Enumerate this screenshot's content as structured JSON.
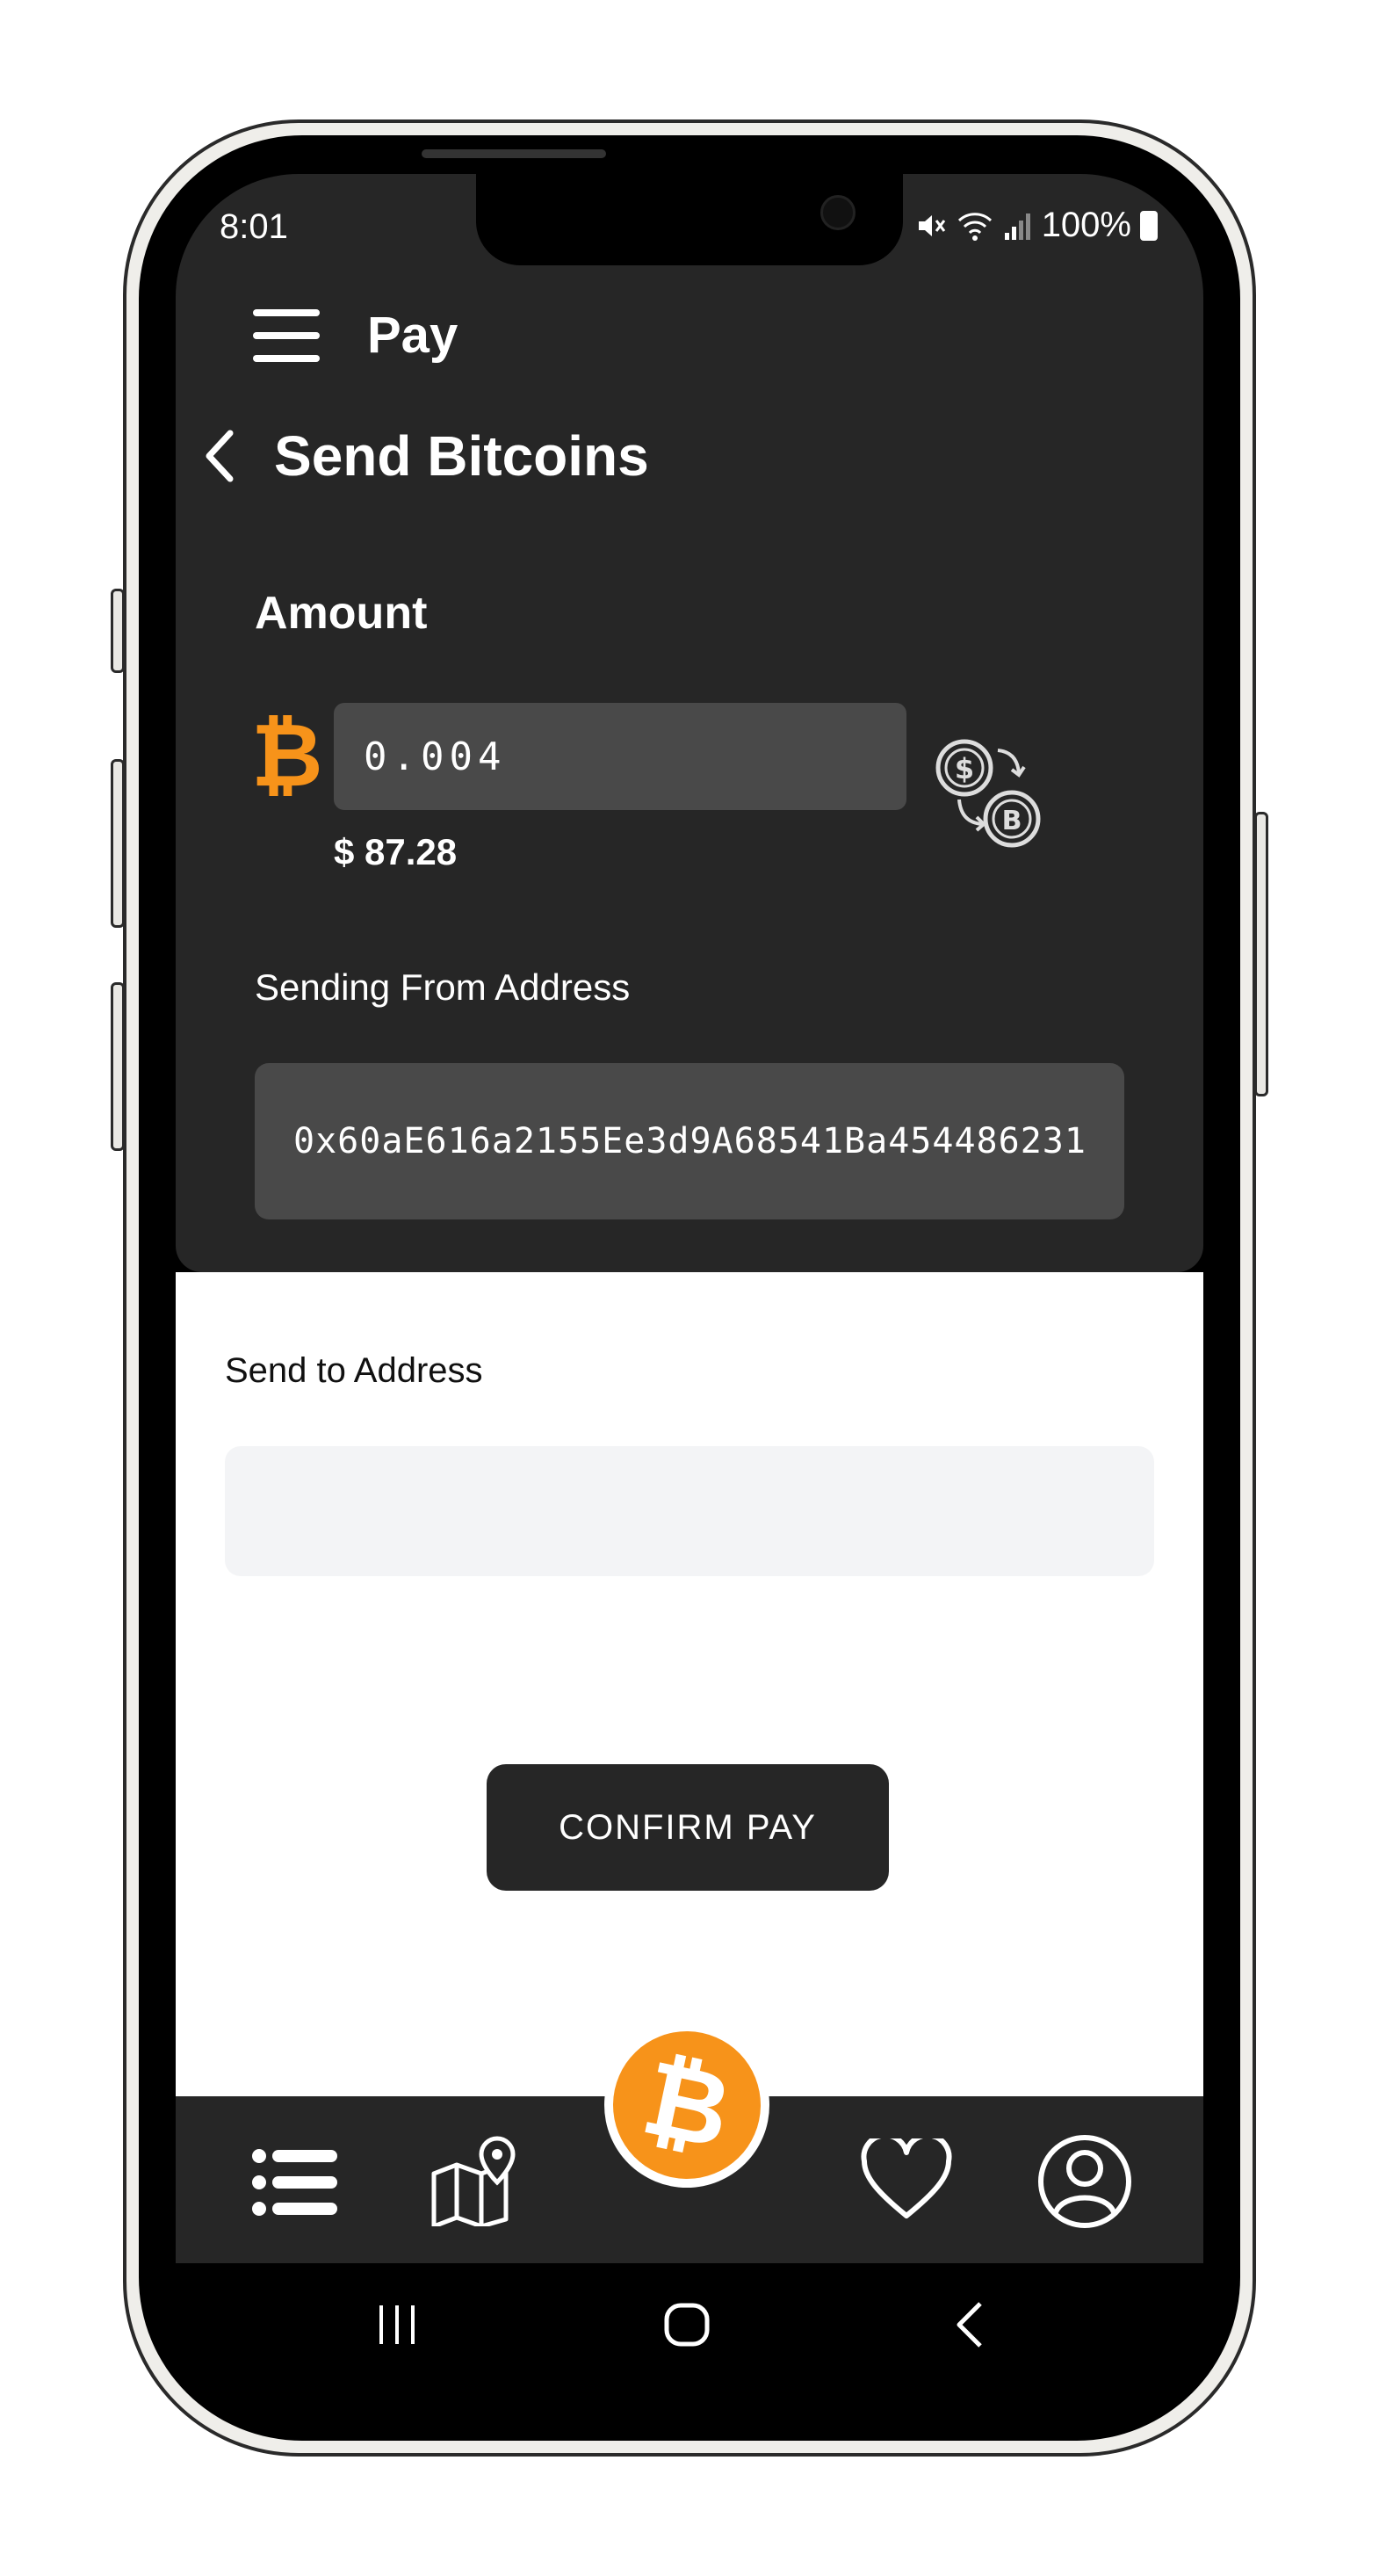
{
  "status_bar": {
    "time": "8:01",
    "battery": "100%"
  },
  "header": {
    "title": "Pay"
  },
  "page": {
    "title": "Send Bitcoins"
  },
  "amount": {
    "label": "Amount",
    "currency_symbol": "₿",
    "value": "0.004",
    "usd_value": "$ 87.28"
  },
  "sending_from": {
    "label": "Sending From Address",
    "address": "0x60aE616a2155Ee3d9A68541Ba454486231"
  },
  "send_to": {
    "label": "Send to Address",
    "value": ""
  },
  "confirm_button": {
    "label": "CONFIRM PAY"
  },
  "bottom_nav": {
    "items": [
      {
        "icon": "list-icon"
      },
      {
        "icon": "map-pin-icon"
      },
      {
        "icon": "bitcoin-icon",
        "symbol": "₿"
      },
      {
        "icon": "heart-icon"
      },
      {
        "icon": "profile-icon"
      }
    ]
  },
  "colors": {
    "accent": "#f7931a",
    "dark_panel": "#262626",
    "input_dark": "#494949",
    "input_light": "#f3f4f6"
  }
}
